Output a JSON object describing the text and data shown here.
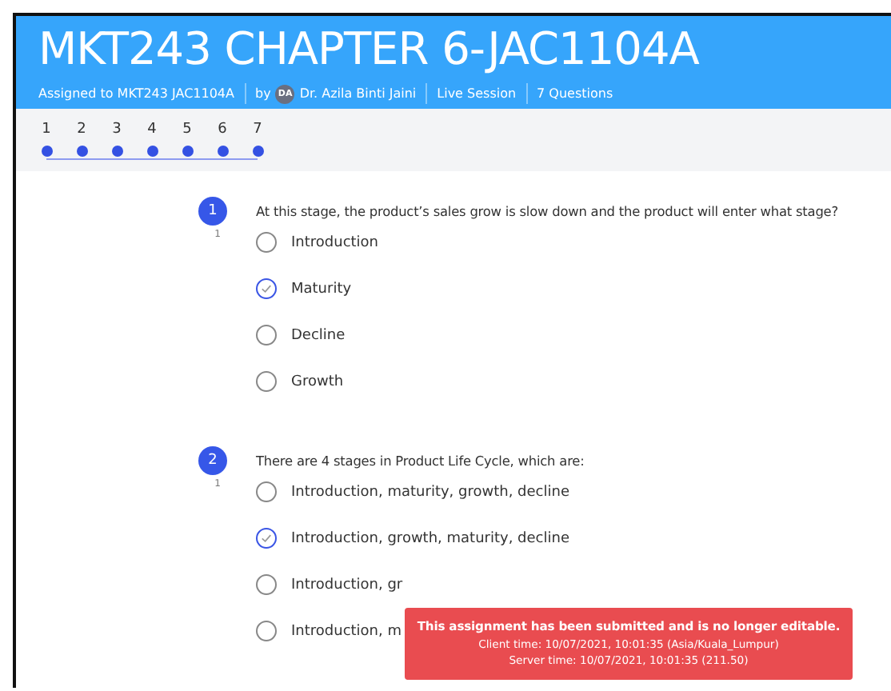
{
  "header": {
    "title": "MKT243 CHAPTER 6-JAC1104A",
    "assigned": "Assigned to MKT243 JAC1104A",
    "by": "by",
    "avatar": "DA",
    "author": "Dr. Azila Binti Jaini",
    "mode": "Live Session",
    "count": "7 Questions"
  },
  "question_nav": [
    "1",
    "2",
    "3",
    "4",
    "5",
    "6",
    "7"
  ],
  "questions": [
    {
      "number": "1",
      "points": "1",
      "text": "At this stage, the product’s sales grow is slow down and the product will enter what stage?",
      "options": [
        {
          "label": "Introduction",
          "selected": false
        },
        {
          "label": "Maturity",
          "selected": true
        },
        {
          "label": "Decline",
          "selected": false
        },
        {
          "label": "Growth",
          "selected": false
        }
      ]
    },
    {
      "number": "2",
      "points": "1",
      "text": "There are 4 stages in Product Life Cycle, which are:",
      "options": [
        {
          "label": "Introduction, maturity, growth, decline",
          "selected": false
        },
        {
          "label": "Introduction, growth, maturity, decline",
          "selected": true
        },
        {
          "label": "Introduction, gr",
          "selected": false
        },
        {
          "label": "Introduction, m",
          "selected": false
        }
      ]
    }
  ],
  "toast": {
    "message": "This assignment has been submitted and is no longer editable.",
    "client_time": "Client time: 10/07/2021, 10:01:35 (Asia/Kuala_Lumpur)",
    "server_time": "Server time: 10/07/2021, 10:01:35 (211.50)"
  }
}
